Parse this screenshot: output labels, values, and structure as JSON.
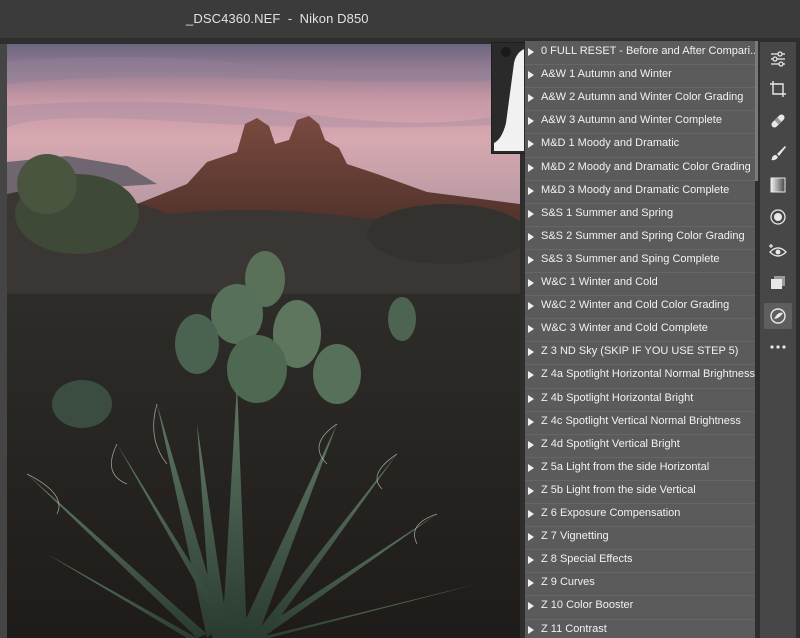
{
  "window": {
    "title": "_DSC4360.NEF  -  Nikon D850"
  },
  "presets": [
    "0 FULL RESET - Before and After Compari...",
    "A&W 1 Autumn and Winter",
    "A&W 2 Autumn and Winter Color Grading",
    "A&W 3 Autumn and Winter Complete",
    "M&D 1 Moody and Dramatic",
    "M&D 2 Moody and Dramatic Color Grading",
    "M&D 3 Moody and Dramatic Complete",
    "S&S 1 Summer and Spring",
    "S&S 2 Summer and Spring Color Grading",
    "S&S 3 Summer and Sping Complete",
    "W&C 1 Winter and Cold",
    "W&C 2 Winter and Cold Color Grading",
    "W&C 3 Winter and Cold Complete",
    "Z 3 ND Sky (SKIP IF YOU USE STEP 5)",
    "Z 4a Spotlight Horizontal Normal Brightness",
    "Z 4b Spotlight Horizontal Bright",
    "Z 4c Spotlight Vertical Normal Brightness",
    "Z 4d Spotlight Vertical Bright",
    "Z 5a Light from the side Horizontal",
    "Z 5b Light from the side Vertical",
    "Z 6 Exposure Compensation",
    "Z 7 Vignetting",
    "Z 8 Special Effects",
    "Z 9 Curves",
    "Z 10 Color Booster",
    "Z 11 Contrast"
  ],
  "toolbar": {
    "tools": [
      {
        "icon": "sliders-icon",
        "active": false
      },
      {
        "icon": "crop-icon",
        "active": false
      },
      {
        "icon": "bandage-icon",
        "active": false
      },
      {
        "icon": "brush-icon",
        "active": false
      },
      {
        "icon": "gradient-icon",
        "active": false
      },
      {
        "icon": "radial-filter-icon",
        "active": false
      },
      {
        "icon": "red-eye-icon",
        "active": false
      },
      {
        "icon": "presets-icon",
        "active": false
      },
      {
        "icon": "masking-icon",
        "active": true
      },
      {
        "icon": "more-icon",
        "active": false
      }
    ]
  },
  "colors": {
    "panel_bg": "#5b5b5b",
    "toolbar_bg": "#474747",
    "titlebar_bg": "#3b3b3b",
    "text": "#f2f2f2"
  }
}
